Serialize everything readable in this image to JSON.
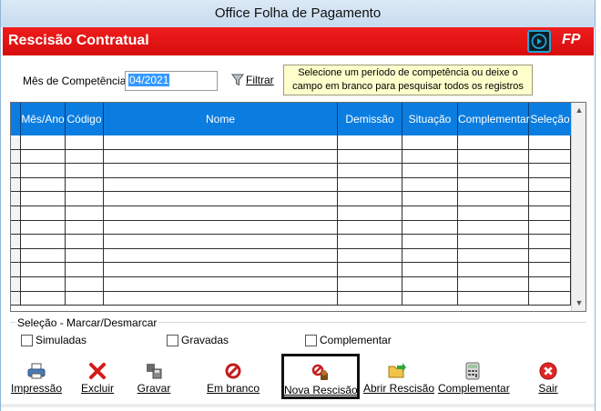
{
  "window": {
    "title": "Office Folha de Pagamento"
  },
  "header": {
    "title": "Rescisão Contratual",
    "logo_text": "FP"
  },
  "filter": {
    "label": "Mês de Competência:",
    "value": "04/2021",
    "filter_button": "Filtrar",
    "hint_line1": "Selecione um período de competência ou deixe o",
    "hint_line2": "campo em branco para pesquisar todos os registros"
  },
  "grid": {
    "columns": [
      "Mês/Ano",
      "Código",
      "Nome",
      "Demissão",
      "Situação",
      "Complementar",
      "Seleção"
    ],
    "rows": []
  },
  "selection": {
    "title": "Seleção - Marcar/Desmarcar",
    "simuladas": "Simuladas",
    "gravadas": "Gravadas",
    "complementar": "Complementar"
  },
  "toolbar": {
    "impressao": "Impressão",
    "excluir": "Excluir",
    "gravar": "Gravar",
    "em_branco": "Em branco",
    "nova_rescisao": "Nova Rescisão",
    "abrir_rescisao": "Abrir Rescisão",
    "complementar": "Complementar",
    "sair": "Sair"
  },
  "colors": {
    "header_red": "#e31414",
    "grid_header_blue": "#0b7de0",
    "hint_bg": "#ffffcc"
  }
}
